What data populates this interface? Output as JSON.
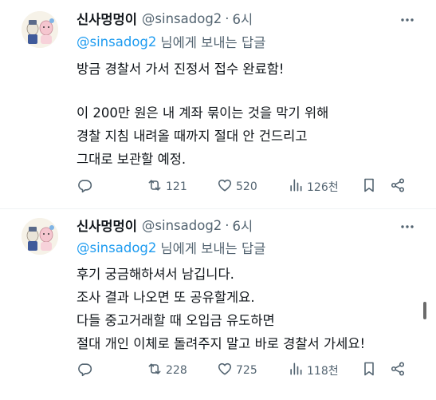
{
  "tweets": [
    {
      "name": "신사멍멍이",
      "handle": "@sinsadog2",
      "dot": "·",
      "time": "6시",
      "reply_to_handle": "@sinsadog2",
      "reply_to_suffix": "님에게 보내는 답글",
      "lines": [
        "방금 경찰서 가서 진정서 접수 완료함!",
        "",
        "이 200만 원은 내 계좌 묶이는 것을 막기 위해",
        "경찰 지침 내려올 때까지 절대 안 건드리고",
        "그대로 보관할 예정."
      ],
      "retweets": "121",
      "likes": "520",
      "views": "126천"
    },
    {
      "name": "신사멍멍이",
      "handle": "@sinsadog2",
      "dot": "·",
      "time": "6시",
      "reply_to_handle": "@sinsadog2",
      "reply_to_suffix": "님에게 보내는 답글",
      "lines": [
        "후기 궁금해하셔서 남깁니다.",
        "조사 결과 나오면 또 공유할게요.",
        "다들 중고거래할 때 오입금 유도하면",
        "절대 개인 이체로 돌려주지 말고 바로 경찰서 가세요!"
      ],
      "retweets": "228",
      "likes": "725",
      "views": "118천"
    }
  ],
  "colors": {
    "text": "#0f1419",
    "secondary": "#536471",
    "link": "#1d9bf0",
    "divider": "#eff3f4"
  },
  "icons": [
    "more-icon",
    "reply-icon",
    "retweet-icon",
    "like-icon",
    "views-icon",
    "bookmark-icon",
    "share-icon"
  ]
}
